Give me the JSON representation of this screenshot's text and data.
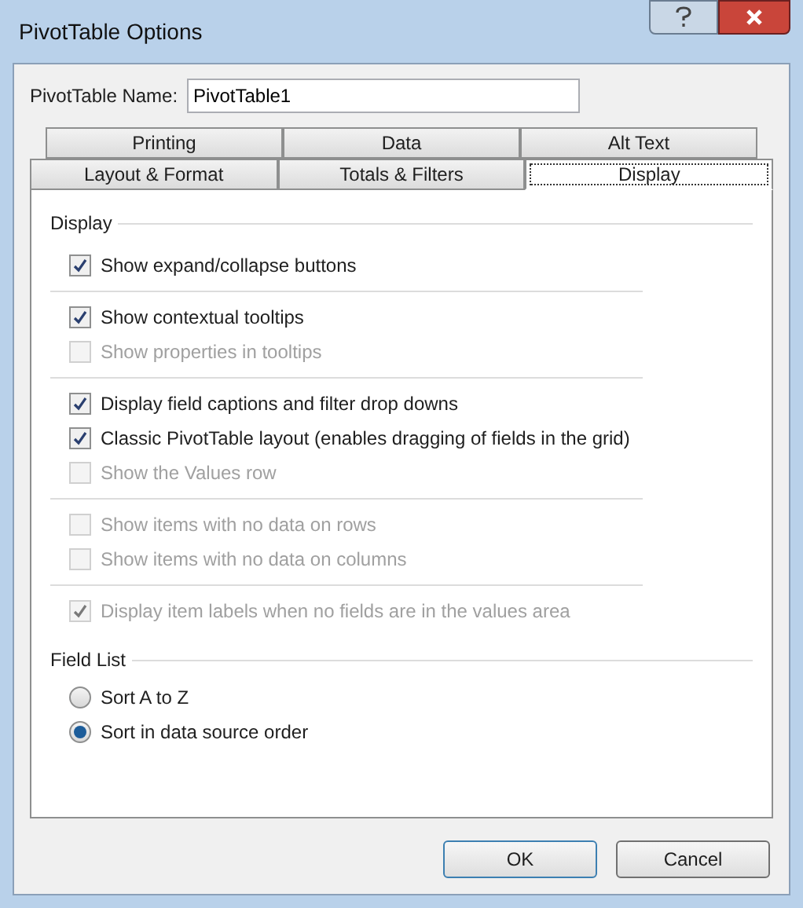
{
  "window": {
    "title": "PivotTable Options"
  },
  "name_field": {
    "label": "PivotTable Name:",
    "value": "PivotTable1"
  },
  "tab_rows": [
    [
      {
        "label": "Printing",
        "selected": false
      },
      {
        "label": "Data",
        "selected": false
      },
      {
        "label": "Alt Text",
        "selected": false
      }
    ],
    [
      {
        "label": "Layout & Format",
        "selected": false
      },
      {
        "label": "Totals & Filters",
        "selected": false
      },
      {
        "label": "Display",
        "selected": true
      }
    ]
  ],
  "display_section": {
    "title": "Display",
    "groups": [
      [
        {
          "label": "Show expand/collapse buttons",
          "checked": true,
          "disabled": false
        }
      ],
      [
        {
          "label": "Show contextual tooltips",
          "checked": true,
          "disabled": false
        },
        {
          "label": "Show properties in tooltips",
          "checked": false,
          "disabled": true
        }
      ],
      [
        {
          "label": "Display field captions and filter drop downs",
          "checked": true,
          "disabled": false
        },
        {
          "label": "Classic PivotTable layout (enables dragging of fields in the grid)",
          "checked": true,
          "disabled": false
        },
        {
          "label": "Show the Values row",
          "checked": false,
          "disabled": true
        }
      ],
      [
        {
          "label": "Show items with no data on rows",
          "checked": false,
          "disabled": true
        },
        {
          "label": "Show items with no data on columns",
          "checked": false,
          "disabled": true
        }
      ],
      [
        {
          "label": "Display item labels when no fields are in the values area",
          "checked": true,
          "disabled": true
        }
      ]
    ]
  },
  "field_list_section": {
    "title": "Field List",
    "options": [
      {
        "label": "Sort A to Z",
        "selected": false
      },
      {
        "label": "Sort in data source order",
        "selected": true
      }
    ]
  },
  "buttons": [
    {
      "label": "OK",
      "kind": "default"
    },
    {
      "label": "Cancel",
      "kind": "normal"
    }
  ]
}
